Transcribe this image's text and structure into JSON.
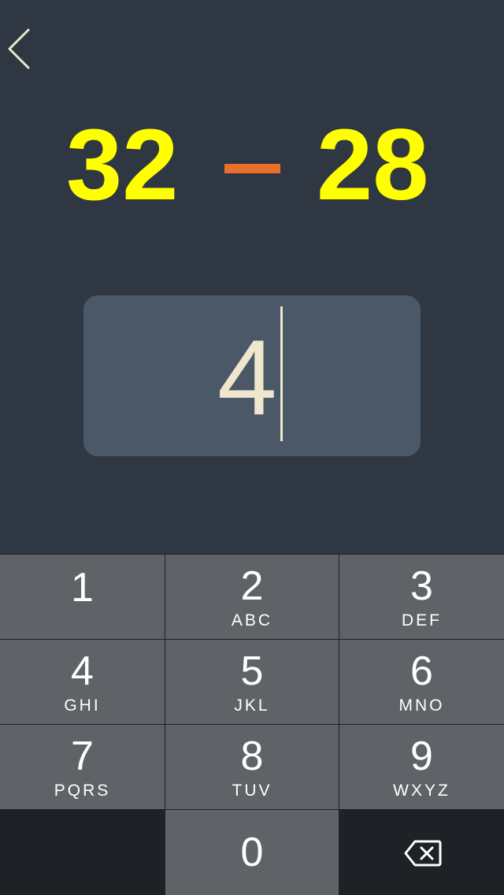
{
  "problem": {
    "left_operand": "32",
    "operator": "−",
    "right_operand": "28"
  },
  "answer": {
    "value": "4"
  },
  "keypad": {
    "keys": [
      {
        "digit": "1",
        "letters": ""
      },
      {
        "digit": "2",
        "letters": "ABC"
      },
      {
        "digit": "3",
        "letters": "DEF"
      },
      {
        "digit": "4",
        "letters": "GHI"
      },
      {
        "digit": "5",
        "letters": "JKL"
      },
      {
        "digit": "6",
        "letters": "MNO"
      },
      {
        "digit": "7",
        "letters": "PQRS"
      },
      {
        "digit": "8",
        "letters": "TUV"
      },
      {
        "digit": "9",
        "letters": "WXYZ"
      },
      {
        "digit": "0",
        "letters": ""
      }
    ]
  },
  "icons": {
    "back": "chevron-left-icon",
    "delete": "backspace-icon"
  },
  "colors": {
    "background": "#2f3842",
    "operand": "#ffff00",
    "operator": "#e8702a",
    "answer_box": "#4a5868",
    "answer_text": "#efe6cd",
    "key": "#5f6368",
    "keypad_dark": "#1e2126"
  }
}
